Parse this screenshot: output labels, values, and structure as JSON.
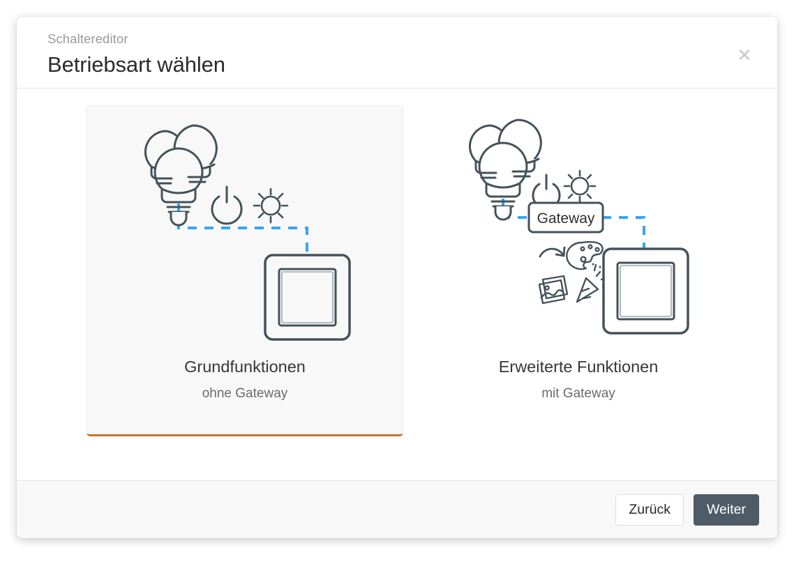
{
  "dialog": {
    "eyebrow": "Schaltereditor",
    "title": "Betriebsart wählen",
    "close_icon": "close-icon"
  },
  "options": [
    {
      "id": "basic",
      "title": "Grundfunktionen",
      "subtitle": "ohne Gateway",
      "selected": true,
      "accent_color": "#c4772f",
      "illustration": {
        "bulbs_icon": "light-bulbs-icon",
        "link_color": "#36a5f5",
        "feature_icons": [
          "power-icon",
          "brightness-icon"
        ],
        "switch_icon": "wall-switch-icon"
      }
    },
    {
      "id": "advanced",
      "title": "Erweiterte Funktionen",
      "subtitle": "mit Gateway",
      "selected": false,
      "illustration": {
        "bulbs_icon": "light-bulbs-icon",
        "link_color": "#36a5f5",
        "gateway_label": "Gateway",
        "feature_icons": [
          "power-icon",
          "brightness-icon",
          "transition-icon",
          "color-palette-icon",
          "scenes-icon",
          "party-popper-icon"
        ],
        "switch_icon": "wall-switch-icon"
      }
    }
  ],
  "footer": {
    "back_label": "Zurück",
    "next_label": "Weiter"
  },
  "colors": {
    "outline": "#43525a",
    "link": "#36a5f5",
    "accent": "#c4772f",
    "primary_button": "#4e5c67"
  }
}
